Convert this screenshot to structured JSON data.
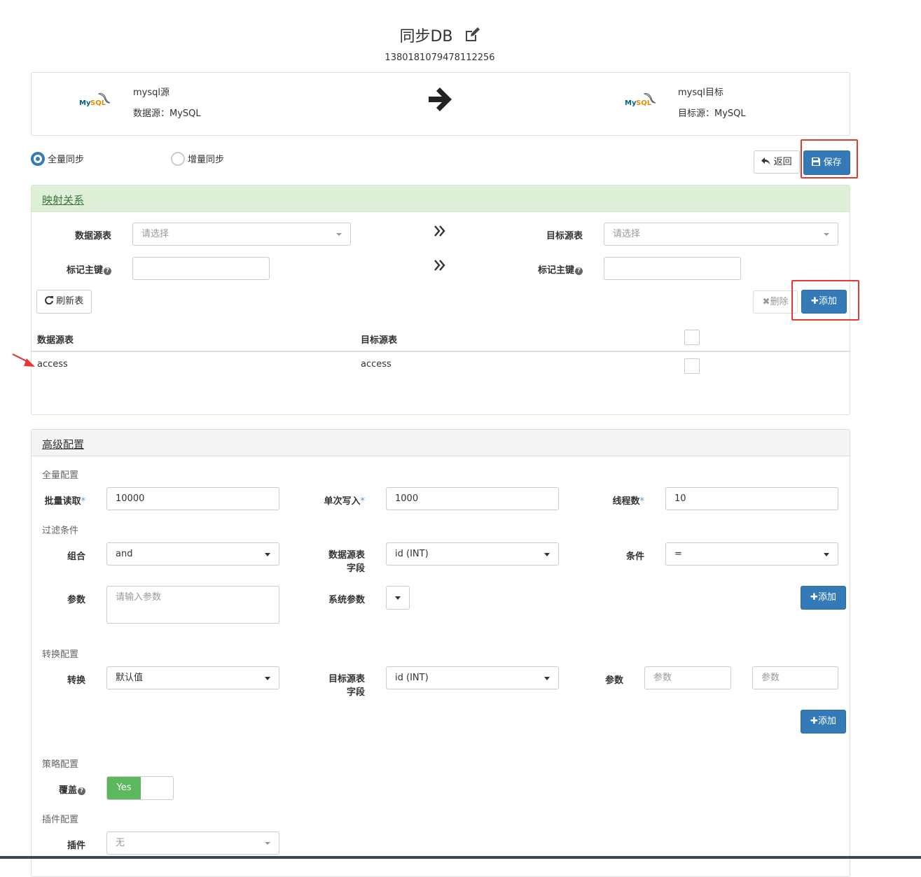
{
  "header": {
    "title": "同步DB",
    "id": "1380181079478112256"
  },
  "source": {
    "name": "mysql源",
    "type_label": "数据源：MySQL",
    "logo_text": "MySQL"
  },
  "target": {
    "name": "mysql目标",
    "type_label": "目标源：MySQL",
    "logo_text": "MySQL"
  },
  "sync_mode": {
    "options": [
      "全量同步",
      "增量同步"
    ],
    "selected": "全量同步"
  },
  "actions": {
    "back_label": "返回",
    "save_label": "保存"
  },
  "mapping": {
    "title": "映射关系",
    "source_table_label": "数据源表",
    "source_table_placeholder": "请选择",
    "target_table_label": "目标源表",
    "target_table_placeholder": "请选择",
    "pk_label_left": "标记主键",
    "pk_label_right": "标记主键",
    "refresh_label": "刷新表",
    "delete_label": "删除",
    "add_label": "添加",
    "columns": [
      "数据源表",
      "目标源表"
    ],
    "rows": [
      {
        "source": "access",
        "target": "access"
      }
    ]
  },
  "advanced": {
    "title": "高级配置",
    "full_section": "全量配置",
    "batch_read_label": "批量读取",
    "batch_read_value": "10000",
    "single_write_label": "单次写入",
    "single_write_value": "1000",
    "threads_label": "线程数",
    "threads_value": "10",
    "filter_section": "过滤条件",
    "combine_label": "组合",
    "combine_value": "and",
    "src_field_label_1": "数据源表",
    "src_field_label_2": "字段",
    "src_field_value": "id (INT)",
    "condition_label": "条件",
    "condition_value": "=",
    "param_label": "参数",
    "param_placeholder": "请输入参数",
    "sys_param_label": "系统参数",
    "filter_add_label": "添加",
    "convert_section": "转换配置",
    "convert_label": "转换",
    "convert_value": "默认值",
    "tgt_field_label_1": "目标源表",
    "tgt_field_label_2": "字段",
    "tgt_field_value": "id (INT)",
    "convert_param_label": "参数",
    "convert_param_placeholder_1": "参数",
    "convert_param_placeholder_2": "参数",
    "convert_add_label": "添加",
    "strategy_section": "策略配置",
    "cover_label": "覆盖",
    "cover_toggle": "Yes",
    "plugin_section": "插件配置",
    "plugin_label": "插件",
    "plugin_value": "无"
  },
  "colors": {
    "primary": "#337ab7",
    "success": "#5cb85c",
    "annotation_red": "#e53935",
    "mapping_header_bg": "#dff0d8"
  }
}
